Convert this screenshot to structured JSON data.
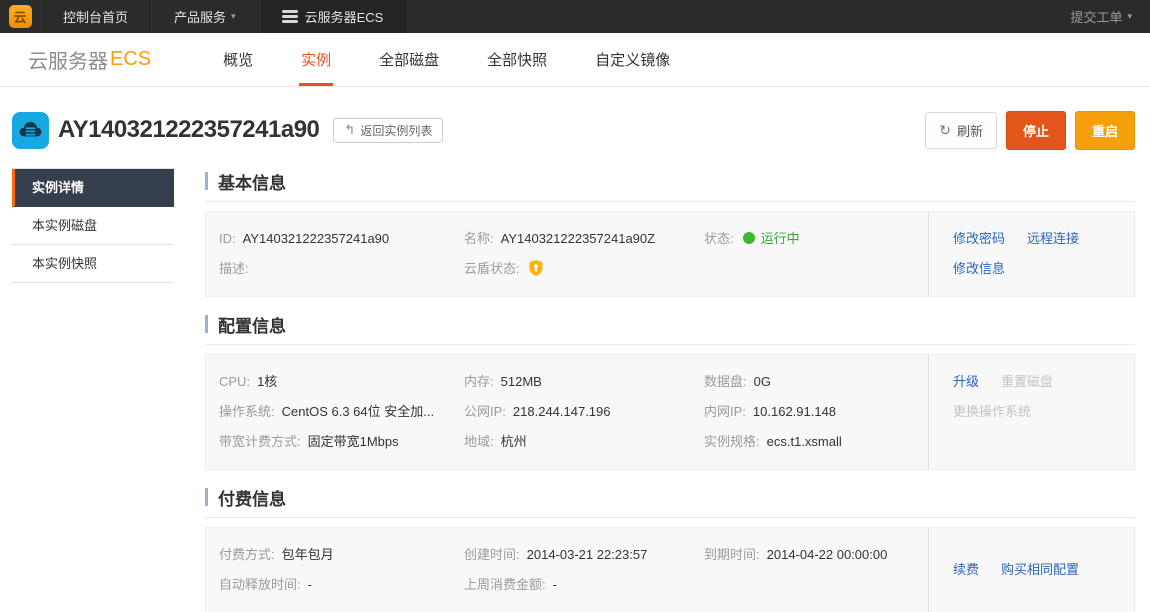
{
  "topnav": {
    "logo": "云",
    "console_home": "控制台首页",
    "products": "产品服务",
    "current_product": "云服务器ECS",
    "submit_ticket": "提交工单"
  },
  "product_header": {
    "title_main": "云服务器",
    "title_accent": "ECS",
    "tabs": [
      {
        "label": "概览"
      },
      {
        "label": "实例"
      },
      {
        "label": "全部磁盘"
      },
      {
        "label": "全部快照"
      },
      {
        "label": "自定义镜像"
      }
    ],
    "active_tab": "实例"
  },
  "instance": {
    "title": "AY140321222357241a90",
    "back_label": "返回实例列表",
    "refresh_label": "刷新",
    "stop_label": "停止",
    "restart_label": "重启"
  },
  "sidebar": [
    {
      "label": "实例详情",
      "active": true
    },
    {
      "label": "本实例磁盘",
      "active": false
    },
    {
      "label": "本实例快照",
      "active": false
    }
  ],
  "basic": {
    "heading": "基本信息",
    "id_label": "ID:",
    "id_value": "AY140321222357241a90",
    "name_label": "名称:",
    "name_value": "AY140321222357241a90Z",
    "status_label": "状态:",
    "status_value": "运行中",
    "desc_label": "描述:",
    "desc_value": "",
    "shield_label": "云盾状态:",
    "actions": {
      "change_password": "修改密码",
      "remote_connect": "远程连接",
      "modify_info": "修改信息"
    }
  },
  "config": {
    "heading": "配置信息",
    "cpu_label": "CPU:",
    "cpu_value": "1核",
    "mem_label": "内存:",
    "mem_value": "512MB",
    "datadisk_label": "数据盘:",
    "datadisk_value": "0G",
    "os_label": "操作系统:",
    "os_value": "CentOS 6.3 64位 安全加...",
    "pubip_label": "公网IP:",
    "pubip_value": "218.244.147.196",
    "privip_label": "内网IP:",
    "privip_value": "10.162.91.148",
    "bandwidth_label": "带宽计费方式:",
    "bandwidth_value": "固定带宽1Mbps",
    "region_label": "地域:",
    "region_value": "杭州",
    "spec_label": "实例规格:",
    "spec_value": "ecs.t1.xsmall",
    "actions": {
      "upgrade": "升级",
      "reset_disk": "重置磁盘",
      "change_os": "更换操作系统"
    }
  },
  "billing": {
    "heading": "付费信息",
    "paytype_label": "付费方式:",
    "paytype_value": "包年包月",
    "created_label": "创建时间:",
    "created_value": "2014-03-21 22:23:57",
    "expire_label": "到期时间:",
    "expire_value": "2014-04-22 00:00:00",
    "release_label": "自动释放时间:",
    "release_value": "-",
    "lastweek_label": "上周消费金额:",
    "lastweek_value": "-",
    "actions": {
      "renew": "续费",
      "buy_same": "购买相同配置"
    }
  },
  "colors": {
    "brand_orange": "#ff6a00",
    "tab_active": "#e4501e",
    "stop_button": "#e2561b",
    "restart_button": "#f5a00b",
    "link_blue": "#2d64b8",
    "status_green": "#3cb92d",
    "sidebar_active_bg": "#353f4e",
    "shield_yellow": "#fdb20e",
    "instance_icon_blue": "#18a8e0"
  }
}
